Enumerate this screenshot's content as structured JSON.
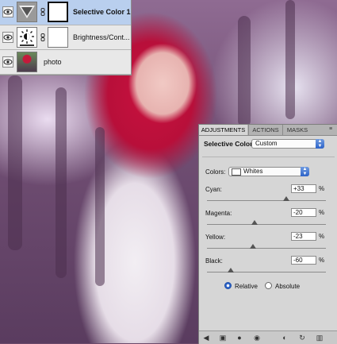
{
  "layers_panel": {
    "layers": [
      {
        "name": "Selective Color 1",
        "selected": true,
        "thumb_icon": "selective-color-adjustment-icon"
      },
      {
        "name": "Brightness/Cont...",
        "selected": false,
        "thumb_icon": "brightness-contrast-adjustment-icon"
      },
      {
        "name": "photo",
        "selected": false,
        "thumb_icon": "photo-thumbnail"
      }
    ]
  },
  "adjustments_panel": {
    "tabs": [
      {
        "label": "ADJUSTMENTS",
        "active": true
      },
      {
        "label": "ACTIONS",
        "active": false
      },
      {
        "label": "MASKS",
        "active": false
      }
    ],
    "title": "Selective Color",
    "preset_value": "Custom",
    "colors_label": "Colors:",
    "colors_value": "Whites",
    "sliders": [
      {
        "label": "Cyan:",
        "value": "+33",
        "unit": "%",
        "level": 33
      },
      {
        "label": "Magenta:",
        "value": "-20",
        "unit": "%",
        "level": -20
      },
      {
        "label": "Yellow:",
        "value": "-23",
        "unit": "%",
        "level": -23
      },
      {
        "label": "Black:",
        "value": "-60",
        "unit": "%",
        "level": -60
      }
    ],
    "method": {
      "relative_label": "Relative",
      "absolute_label": "Absolute",
      "selected": "Relative"
    },
    "bottom_icons": [
      "back-arrow-icon",
      "expanded-view-icon",
      "clip-to-layer-icon",
      "visibility-eye-icon",
      "view-previous-state-icon",
      "reset-icon",
      "delete-trash-icon"
    ]
  },
  "colors": {
    "selected_layer_bg": "#b9cfee",
    "panel_bg": "#d6d6d6",
    "accent_blue": "#2d63c8"
  }
}
